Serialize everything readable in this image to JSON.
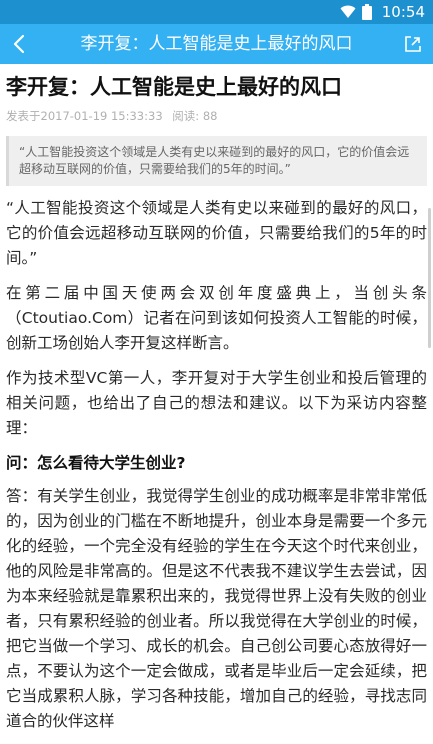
{
  "status_bar": {
    "time": "10:54"
  },
  "app_bar": {
    "title": "李开复：人工智能是史上最好的风口"
  },
  "article": {
    "headline": "李开复：人工智能是史上最好的风口",
    "meta": {
      "published": "发表于2017-01-19 15:33:33",
      "reads": "阅读: 88"
    },
    "summary": "“人工智能投资这个领域是人类有史以来碰到的最好的风口，它的价值会远超移动互联网的价值，只需要给我们的5年的时间。”",
    "paragraphs": [
      "“人工智能投资这个领域是人类有史以来碰到的最好的风口，它的价值会远超移动互联网的价值，只需要给我们的5年的时间。”",
      "在第二届中国天使两会双创年度盛典上，当创头条（Ctoutiao.Com）记者在问到该如何投资人工智能的时候，创新工场创始人李开复这样断言。",
      "作为技术型VC第一人，李开复对于大学生创业和投后管理的相关问题，也给出了自己的想法和建议。以下为采访内容整理：",
      "问：怎么看待大学生创业?",
      "答：有关学生创业，我觉得学生创业的成功概率是非常非常低的，因为创业的门槛在不断地提升，创业本身是需要一个多元化的经验，一个完全没有经验的学生在今天这个时代来创业，他的风险是非常高的。但是这不代表我不建议学生去尝试，因为本来经验就是靠累积出来的，我觉得世界上没有失败的创业者，只有累积经验的创业者。所以我觉得在大学创业的时候，把它当做一个学习、成长的机会。自己创公司要心态放得好一点，不要认为这个一定会做成，或者是毕业后一定会延续，把它当成累积人脉，学习各种技能，增加自己的经验，寻找志同道合的伙伴这样"
    ]
  },
  "colors": {
    "status_bar": "#1d90cf",
    "app_bar": "#33b1f2",
    "summary_bg": "#efefef"
  },
  "icons": {
    "back": "chevron-left-icon",
    "share": "share-icon",
    "wifi": "wifi-icon",
    "battery": "battery-icon"
  }
}
